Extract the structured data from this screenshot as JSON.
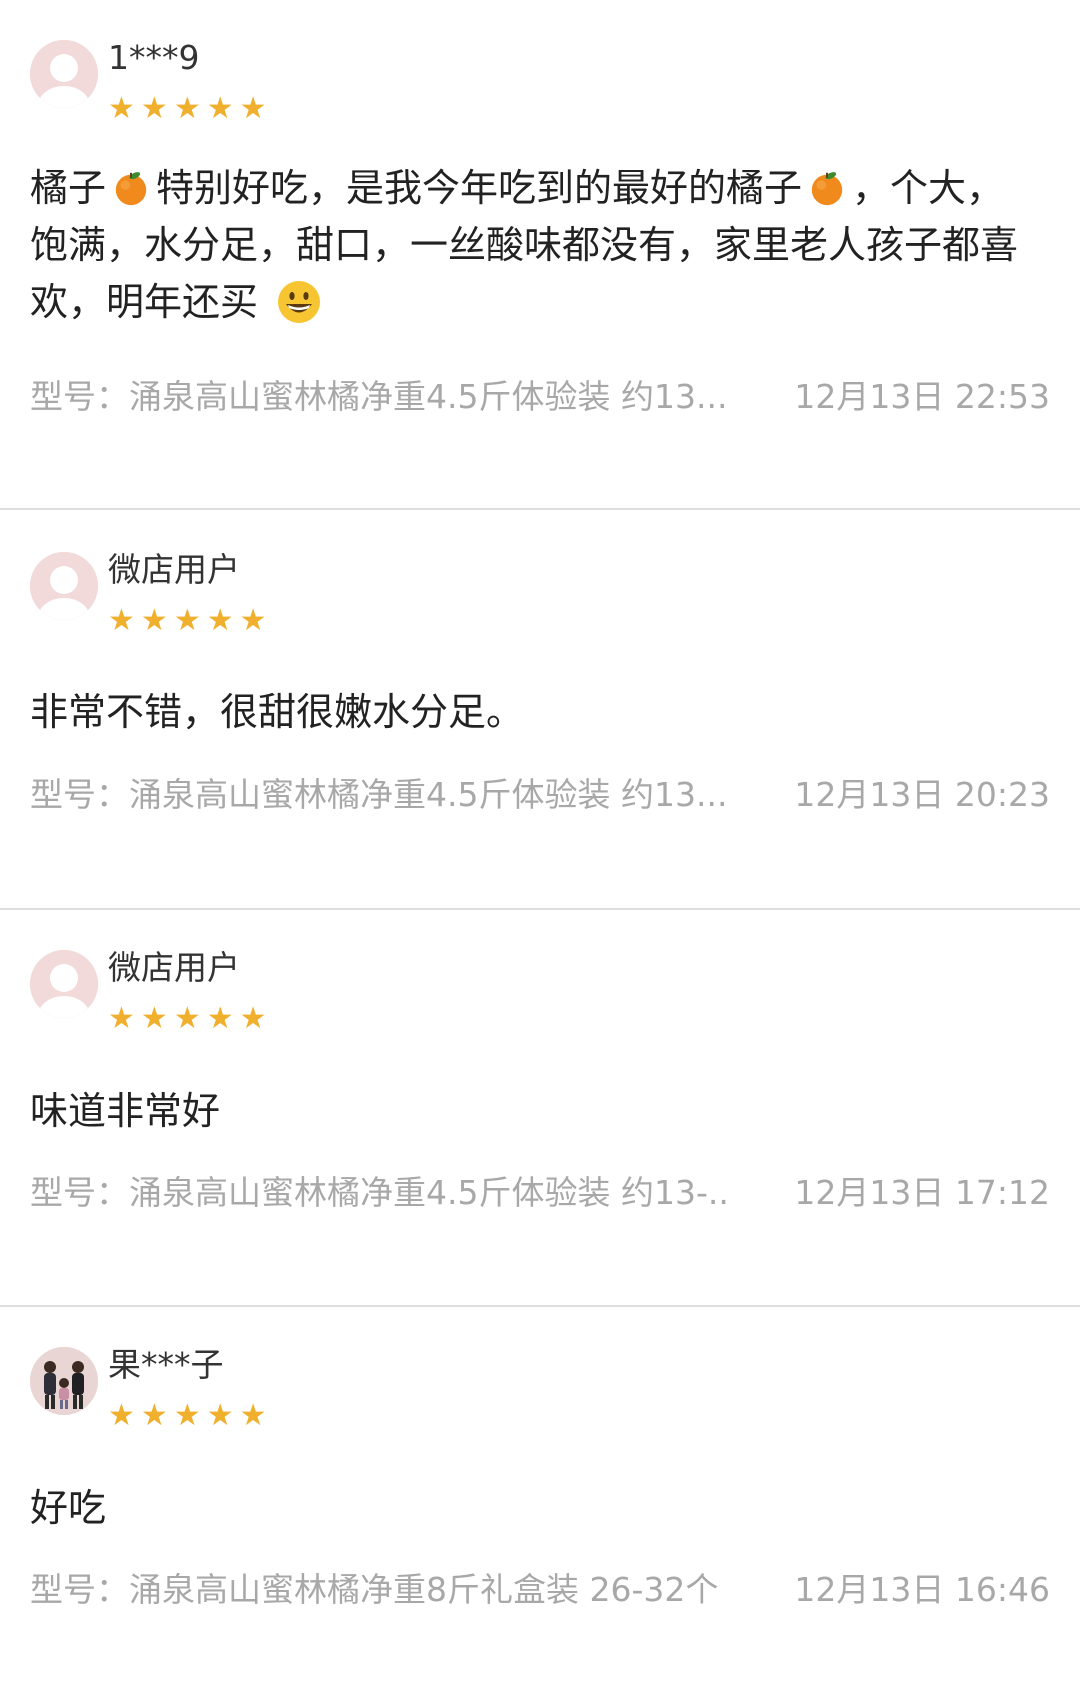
{
  "reviews": [
    {
      "username": "1***9",
      "rating": 5,
      "content_parts": [
        "橘子",
        "特别好吃，是我今年吃到的最好的橘子",
        "，个大，饱满，水分足，甜口，一丝酸味都没有，家里老人孩子都喜欢，明年还买"
      ],
      "model": "型号：涌泉高山蜜林橘净重4.5斤体验装 约13...",
      "time": "12月13日 22:53"
    },
    {
      "username": "微店用户",
      "rating": 5,
      "content": "非常不错，很甜很嫩水分足。",
      "model": "型号：涌泉高山蜜林橘净重4.5斤体验装 约13...",
      "time": "12月13日 20:23"
    },
    {
      "username": "微店用户",
      "rating": 5,
      "content": "味道非常好",
      "model": "型号：涌泉高山蜜林橘净重4.5斤体验装 约13-...",
      "time": "12月13日 17:12"
    },
    {
      "username": "果***子",
      "rating": 5,
      "content": "好吃",
      "model": "型号：涌泉高山蜜林橘净重8斤礼盒装 26-32个",
      "time": "12月13日 16:46"
    }
  ],
  "icons": {
    "star": "star-icon",
    "avatar_default": "default-avatar-icon",
    "emoji_orange": "tangerine-emoji-icon",
    "emoji_smile": "grinning-face-emoji-icon"
  },
  "colors": {
    "star": "#f0b02e",
    "meta_text": "#a8a8a8",
    "divider": "#dedede",
    "avatar_bg": "#f2dada"
  }
}
